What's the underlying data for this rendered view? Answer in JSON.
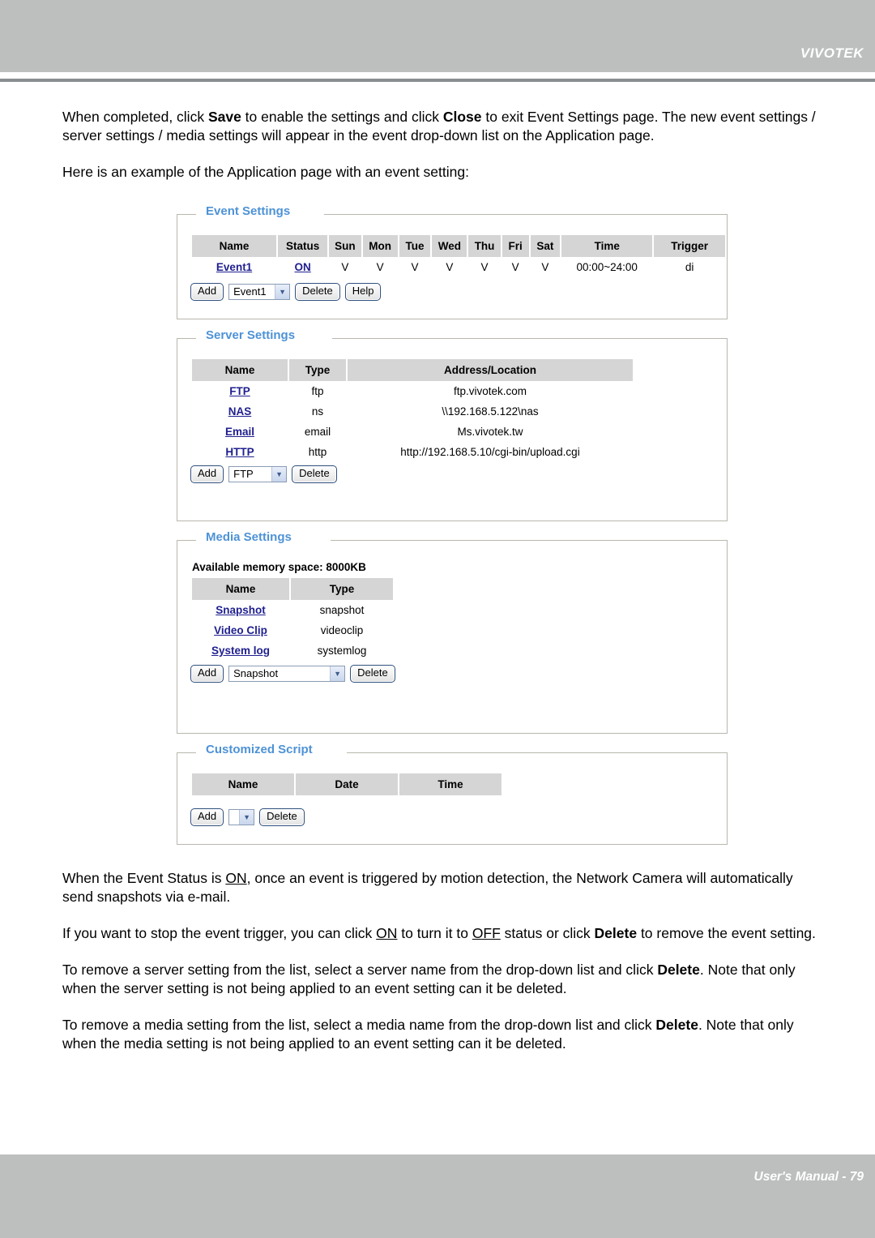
{
  "header": {
    "brand": "VIVOTEK"
  },
  "footer": {
    "text": "User's Manual - 79"
  },
  "intro": {
    "p1_a": "When completed, click ",
    "p1_save": "Save",
    "p1_b": " to enable the settings and click ",
    "p1_close": "Close",
    "p1_c": " to exit Event Settings page. The new event settings / server settings / media settings will appear in the event drop-down list on the Application page.",
    "p2": "Here is an example of the Application page with an event setting:"
  },
  "event_settings": {
    "legend": "Event Settings",
    "columns": [
      "Name",
      "Status",
      "Sun",
      "Mon",
      "Tue",
      "Wed",
      "Thu",
      "Fri",
      "Sat",
      "Time",
      "Trigger"
    ],
    "rows": [
      {
        "name": "Event1",
        "status": "ON",
        "sun": "V",
        "mon": "V",
        "tue": "V",
        "wed": "V",
        "thu": "V",
        "fri": "V",
        "sat": "V",
        "time": "00:00~24:00",
        "trigger": "di"
      }
    ],
    "add_label": "Add",
    "select_value": "Event1",
    "delete_label": "Delete",
    "help_label": "Help"
  },
  "server_settings": {
    "legend": "Server Settings",
    "columns": [
      "Name",
      "Type",
      "Address/Location"
    ],
    "rows": [
      {
        "name": "FTP",
        "type": "ftp",
        "address": "ftp.vivotek.com"
      },
      {
        "name": "NAS",
        "type": "ns",
        "address": "\\\\192.168.5.122\\nas"
      },
      {
        "name": "Email",
        "type": "email",
        "address": "Ms.vivotek.tw"
      },
      {
        "name": "HTTP",
        "type": "http",
        "address": "http://192.168.5.10/cgi-bin/upload.cgi"
      }
    ],
    "add_label": "Add",
    "select_value": "FTP",
    "delete_label": "Delete"
  },
  "media_settings": {
    "legend": "Media Settings",
    "memory_line": "Available memory space: 8000KB",
    "columns": [
      "Name",
      "Type"
    ],
    "rows": [
      {
        "name": "Snapshot",
        "type": "snapshot"
      },
      {
        "name": "Video Clip",
        "type": "videoclip"
      },
      {
        "name": "System log",
        "type": "systemlog"
      }
    ],
    "add_label": "Add",
    "select_value": "Snapshot",
    "delete_label": "Delete"
  },
  "customized_script": {
    "legend": "Customized Script",
    "columns": [
      "Name",
      "Date",
      "Time"
    ],
    "rows": [],
    "add_label": "Add",
    "select_value": "",
    "delete_label": "Delete"
  },
  "outro": {
    "p3_a": "When the Event Status is ",
    "p3_on": "ON",
    "p3_b": ", once an event is triggered by motion detection, the Network Camera will automatically send snapshots via e-mail.",
    "p4_a": "If you want to stop the event trigger, you can click ",
    "p4_on": "ON",
    "p4_b": " to turn it to ",
    "p4_off": "OFF",
    "p4_c": " status or click ",
    "p4_delete": "Delete",
    "p4_d": " to remove the event setting.",
    "p5_a": "To remove a server setting from the list, select a server name from the drop-down list and click ",
    "p5_delete": "Delete",
    "p5_b": ". Note that only when the server setting is not being applied to an event setting can it be deleted.",
    "p6_a": "To remove a media setting from the list, select a media name from the drop-down list and click ",
    "p6_delete": "Delete",
    "p6_b": ". Note that only when the media setting is not being applied to an event setting can it be deleted."
  },
  "icons": {
    "caret": "chevron-down-icon"
  },
  "colors": {
    "header_gray": "#bcbfbe",
    "legend_blue": "#4e92d6",
    "link_navy": "#1f1f8f",
    "th_gray": "#d5d5d5"
  }
}
